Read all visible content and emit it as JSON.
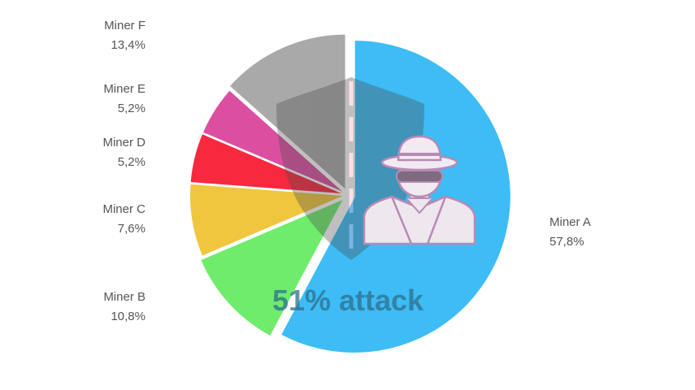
{
  "chart_data": {
    "type": "pie",
    "title": "",
    "slices": [
      {
        "label": "Miner A",
        "value": 57.8,
        "value_label": "57,8%",
        "color": "#3dbcf5"
      },
      {
        "label": "Miner B",
        "value": 10.8,
        "value_label": "10,8%",
        "color": "#6fec6b"
      },
      {
        "label": "Miner C",
        "value": 7.6,
        "value_label": "7,6%",
        "color": "#f0c63e"
      },
      {
        "label": "Miner D",
        "value": 5.2,
        "value_label": "5,2%",
        "color": "#f8283f"
      },
      {
        "label": "Miner E",
        "value": 5.2,
        "value_label": "5,2%",
        "color": "#dc4fa0"
      },
      {
        "label": "Miner F",
        "value": 13.4,
        "value_label": "13,4%",
        "color": "#a9a9a9"
      }
    ],
    "annotation": "51% attack",
    "icons": [
      "shield-icon",
      "spy-hacker-icon"
    ]
  }
}
